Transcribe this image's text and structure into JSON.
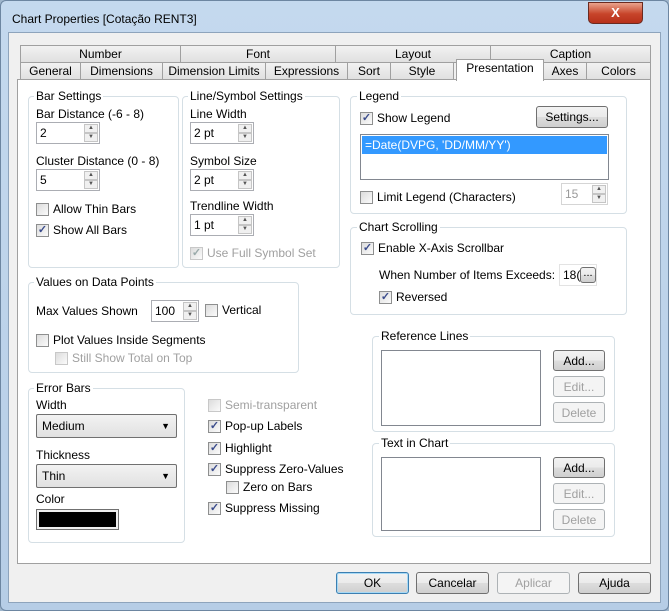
{
  "window": {
    "title": "Chart Properties [Cotação RENT3]",
    "close_label": "X"
  },
  "tabs_row1": [
    "Number",
    "Font",
    "Layout",
    "Caption"
  ],
  "tabs_row2": [
    "General",
    "Dimensions",
    "Dimension Limits",
    "Expressions",
    "Sort",
    "Style",
    "Presentation",
    "Axes",
    "Colors"
  ],
  "active_tab": "Presentation",
  "bar_settings": {
    "title": "Bar Settings",
    "bar_distance_label": "Bar Distance (-6 - 8)",
    "bar_distance": "2",
    "cluster_distance_label": "Cluster Distance (0 - 8)",
    "cluster_distance": "5",
    "allow_thin_bars": {
      "label": "Allow Thin Bars",
      "checked": false
    },
    "show_all_bars": {
      "label": "Show All Bars",
      "checked": true
    }
  },
  "line_symbol": {
    "title": "Line/Symbol Settings",
    "line_width_label": "Line Width",
    "line_width": "2 pt",
    "symbol_size_label": "Symbol Size",
    "symbol_size": "2 pt",
    "trendline_width_label": "Trendline Width",
    "trendline_width": "1 pt",
    "use_full_symbol_set": {
      "label": "Use Full Symbol Set",
      "checked": true,
      "disabled": true
    }
  },
  "values_on_data_points": {
    "title": "Values on Data Points",
    "max_values_label": "Max Values Shown",
    "max_values": "100",
    "vertical": {
      "label": "Vertical",
      "checked": false
    },
    "plot_inside": {
      "label": "Plot Values Inside Segments",
      "checked": false
    },
    "still_show_total": {
      "label": "Still Show Total on Top",
      "checked": false,
      "disabled": true
    }
  },
  "error_bars": {
    "title": "Error Bars",
    "width_label": "Width",
    "width": "Medium",
    "thickness_label": "Thickness",
    "thickness": "Thin",
    "color_label": "Color",
    "color": "#000000"
  },
  "misc": {
    "semi_transparent": {
      "label": "Semi-transparent",
      "checked": false,
      "disabled": true
    },
    "popup_labels": {
      "label": "Pop-up Labels",
      "checked": true
    },
    "highlight": {
      "label": "Highlight",
      "checked": true
    },
    "suppress_zero": {
      "label": "Suppress Zero-Values",
      "checked": true
    },
    "zero_on_bars": {
      "label": "Zero on Bars",
      "checked": false
    },
    "suppress_missing": {
      "label": "Suppress Missing",
      "checked": true
    }
  },
  "legend": {
    "title": "Legend",
    "show_legend": {
      "label": "Show Legend",
      "checked": true
    },
    "settings_button": "Settings...",
    "items": [
      "=Date(DVPG, 'DD/MM/YY')"
    ],
    "limit_legend": {
      "label": "Limit Legend (Characters)",
      "checked": false
    },
    "limit_value": "15"
  },
  "chart_scrolling": {
    "title": "Chart Scrolling",
    "enable_scrollbar": {
      "label": "Enable X-Axis Scrollbar",
      "checked": true
    },
    "items_exceeds_label": "When Number of Items Exceeds:",
    "items_exceeds_value": "18(",
    "browse_button": "...",
    "reversed": {
      "label": "Reversed",
      "checked": true
    }
  },
  "reference_lines": {
    "title": "Reference Lines",
    "add": "Add...",
    "edit": "Edit...",
    "delete": "Delete"
  },
  "text_in_chart": {
    "title": "Text in Chart",
    "add": "Add...",
    "edit": "Edit...",
    "delete": "Delete"
  },
  "footer": {
    "ok": "OK",
    "cancel": "Cancelar",
    "apply": "Aplicar",
    "help": "Ajuda"
  },
  "colors": {
    "selection": "#3399ff",
    "close": "#c7442a"
  }
}
